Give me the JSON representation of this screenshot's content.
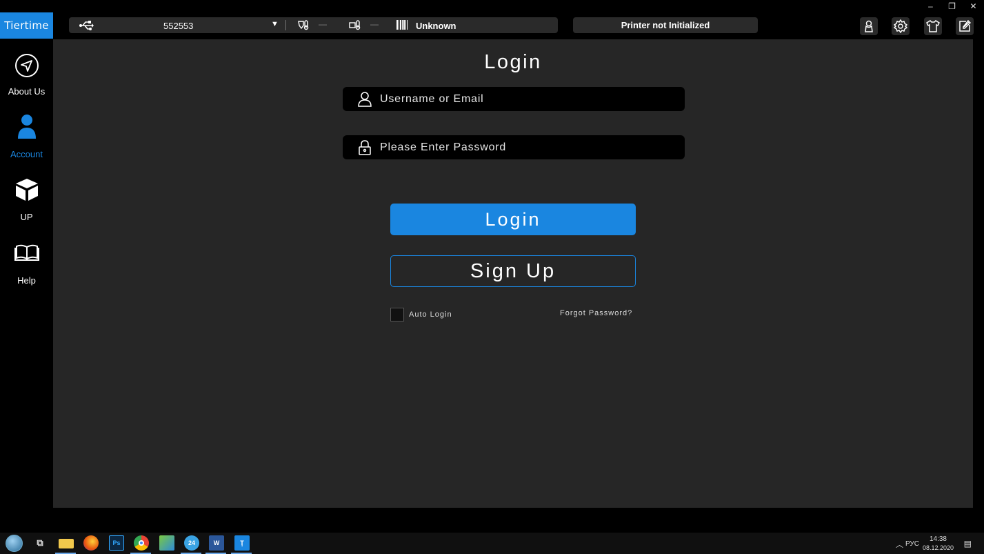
{
  "window": {
    "controls": [
      "–",
      "❐",
      "✕"
    ]
  },
  "logo": "Tiertime",
  "printer": {
    "id": "552553",
    "nozzle_temp": "—",
    "bed_temp": "—",
    "material": "Unknown"
  },
  "status": "Printer not Initialized",
  "top_icons": [
    "account-icon",
    "settings-icon",
    "tshirt-icon",
    "edit-icon"
  ],
  "sidebar": {
    "items": [
      {
        "label": "About Us",
        "icon": "navigate-icon",
        "active": false
      },
      {
        "label": "Account",
        "icon": "person-icon",
        "active": true
      },
      {
        "label": "UP",
        "icon": "cube-icon",
        "active": false
      },
      {
        "label": "Help",
        "icon": "book-icon",
        "active": false
      }
    ]
  },
  "login": {
    "title": "Login",
    "username_placeholder": "Username or Email",
    "password_placeholder": "Please Enter Password",
    "login_label": "Login",
    "signup_label": "Sign Up",
    "auto_login_label": "Auto Login",
    "forgot_label": "Forgot Password?"
  },
  "taskbar": {
    "apps": [
      "start",
      "task-view",
      "file-explorer",
      "firefox",
      "photoshop",
      "chrome",
      "settings",
      "app-24",
      "word",
      "up-studio"
    ],
    "tray": {
      "language": "РУС",
      "time": "14:38",
      "date": "08.12.2020"
    }
  },
  "colors": {
    "accent": "#1a86e0",
    "panel": "#262626",
    "background": "#000000"
  }
}
